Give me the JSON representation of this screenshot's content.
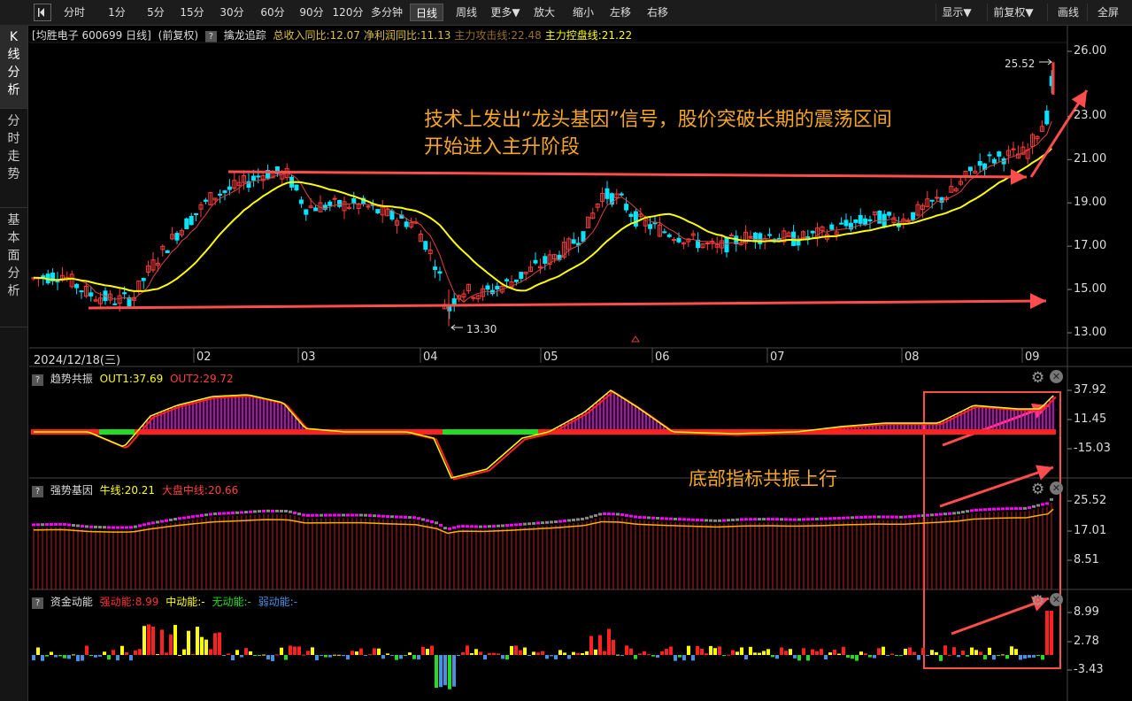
{
  "toolbar": {
    "back_icon": "back-arrow-icon",
    "periods": [
      "分时",
      "1分",
      "5分",
      "15分",
      "30分",
      "60分",
      "90分",
      "120分",
      "多分钟",
      "日线",
      "周线",
      "更多▼",
      "放大",
      "缩小",
      "左移",
      "右移"
    ],
    "active_period": "日线",
    "right_buttons": [
      "显示▼",
      "前复权▼",
      "画线",
      "全屏"
    ]
  },
  "side_tabs": [
    "K线分析",
    "分时走势",
    "基本面分析"
  ],
  "main_pane": {
    "title": "均胜电子 600699 日线",
    "adjust": "(前复权)",
    "help": "?",
    "indicator_name": "擒龙追踪",
    "indicator_values": [
      {
        "text": "总收入同比:12.07",
        "color": "#e0c040"
      },
      {
        "text": "净利润同比:11.13",
        "color": "#e0c040"
      },
      {
        "text": "主力攻击线:22.48",
        "color": "#9a6f2a"
      },
      {
        "text": "主力控盘线:21.22",
        "color": "#ffff00"
      }
    ],
    "y_ticks": [
      "26.00",
      "23.00",
      "21.00",
      "19.00",
      "17.00",
      "15.00",
      "13.00"
    ],
    "high_label": "25.52",
    "low_label": "13.30",
    "callout_lines": [
      "技术上发出“龙头基因”信号，股价突破长期的震荡区间",
      "开始进入主升阶段"
    ]
  },
  "date_axis": {
    "start": "2024/12/18(三)",
    "months": [
      "02",
      "03",
      "04",
      "05",
      "06",
      "07",
      "08",
      "09"
    ]
  },
  "pane_trend": {
    "name": "趋势共振",
    "out1": "OUT1:37.69",
    "out2": "OUT2:29.72",
    "y_ticks": [
      "37.92",
      "11.45",
      "-15.03"
    ],
    "callout": "底部指标共振上行"
  },
  "pane_strength": {
    "name": "强势基因",
    "bull": "牛线:20.21",
    "market": "大盘中线:20.66",
    "y_ticks": [
      "25.52",
      "17.01",
      "8.51"
    ]
  },
  "pane_fund": {
    "name": "资金动能",
    "strong": "强动能:8.99",
    "mid": "中动能:-",
    "none": "无动能:-",
    "weak": "弱动能:-",
    "y_ticks": [
      "8.99",
      "2.78",
      "-3.43"
    ]
  },
  "pane_icons": [
    "gear-icon",
    "close-icon"
  ],
  "colors": {
    "up": "#ff3b3b",
    "down": "#00e5ff",
    "ma_yellow": "#ffff00",
    "callout": "#f5a623",
    "arrow": "#ff4d4d",
    "magenta": "#ff00ff",
    "green": "#22dd22",
    "blue": "#4a90e2"
  },
  "chart_data": {
    "type": "candlestick",
    "series": [
      {
        "name": "K线 close (approx)",
        "x": [
          "2024-12-18",
          "2025-01-02",
          "2025-01-15",
          "2025-02-03",
          "2025-02-20",
          "2025-03-03",
          "2025-03-20",
          "2025-04-07",
          "2025-04-20",
          "2025-05-06",
          "2025-05-20",
          "2025-06-03",
          "2025-06-20",
          "2025-07-03",
          "2025-07-20",
          "2025-08-04",
          "2025-08-20",
          "2025-09-03",
          "2025-09-10"
        ],
        "values": [
          15.5,
          15.3,
          14.6,
          16.0,
          19.2,
          20.0,
          18.6,
          18.3,
          13.9,
          15.3,
          17.0,
          19.6,
          17.8,
          17.5,
          17.6,
          18.1,
          19.5,
          21.6,
          25.5
        ]
      }
    ],
    "ylim": [
      13.0,
      26.0
    ],
    "high": 25.52,
    "low": 13.3
  }
}
